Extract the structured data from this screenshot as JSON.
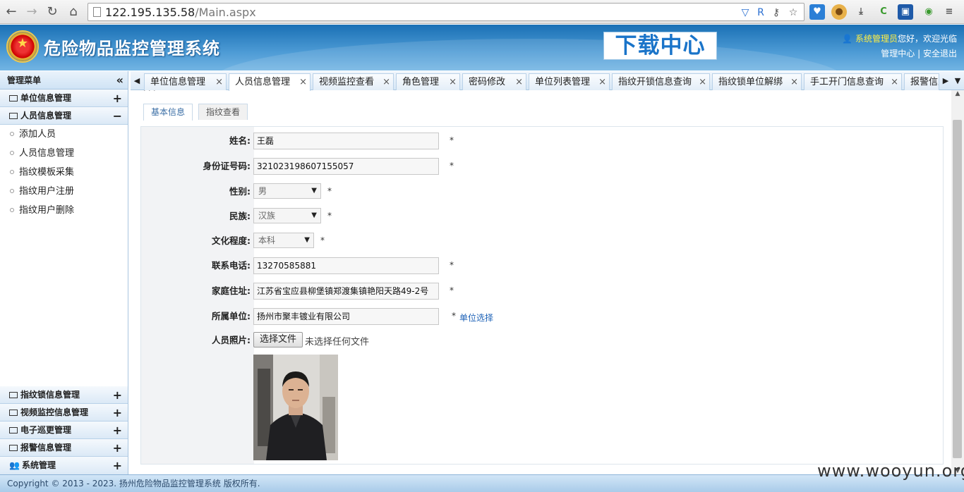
{
  "browser": {
    "url_host": "122.195.135.58",
    "url_path": "/Main.aspx"
  },
  "header": {
    "title": "危险物品监控管理系统",
    "download_label": "下载中心",
    "user_name": "系统管理员",
    "greeting": "您好，欢迎光临",
    "admin_center": "管理中心",
    "separator": "|",
    "logout": "安全退出"
  },
  "sidebar": {
    "title": "管理菜单",
    "top_sections": [
      {
        "label": "单位信息管理",
        "toggle": "+"
      },
      {
        "label": "人员信息管理",
        "toggle": "−"
      }
    ],
    "items": [
      "添加人员",
      "人员信息管理",
      "指纹模板采集",
      "指纹用户注册",
      "指纹用户删除"
    ],
    "bottom_sections": [
      {
        "label": "指纹锁信息管理",
        "toggle": "+"
      },
      {
        "label": "视频监控信息管理",
        "toggle": "+"
      },
      {
        "label": "电子巡更管理",
        "toggle": "+"
      },
      {
        "label": "报警信息管理",
        "toggle": "+"
      },
      {
        "label": "系统管理",
        "toggle": "+"
      }
    ]
  },
  "tabs": [
    {
      "label": "单位信息管理"
    },
    {
      "label": "人员信息管理"
    },
    {
      "label": "视频监控查看"
    },
    {
      "label": "角色管理"
    },
    {
      "label": "密码修改"
    },
    {
      "label": "单位列表管理"
    },
    {
      "label": "指纹开锁信息查询"
    },
    {
      "label": "指纹锁单位解绑"
    },
    {
      "label": "手工开门信息查询"
    },
    {
      "label": "报警信息"
    }
  ],
  "inner_tabs": [
    "基本信息",
    "指纹查看"
  ],
  "form": {
    "name_label": "姓名:",
    "name_value": "王磊",
    "id_label": "身份证号码:",
    "id_value": "321023198607155057",
    "gender_label": "性别:",
    "gender_value": "男",
    "ethnic_label": "民族:",
    "ethnic_value": "汉族",
    "edu_label": "文化程度:",
    "edu_value": "本科",
    "phone_label": "联系电话:",
    "phone_value": "13270585881",
    "address_label": "家庭住址:",
    "address_value": "江苏省宝应县柳堡镇郑渡集镇艳阳天路49-2号",
    "unit_label": "所属单位:",
    "unit_value": "扬州市聚丰镀业有限公司",
    "unit_select": "单位选择",
    "photo_label": "人员照片:",
    "file_button": "选择文件",
    "file_none": "未选择任何文件",
    "required": "*"
  },
  "footer": {
    "copyright": "Copyright © 2013 - 2023. 扬州危险物品监控管理系统 版权所有."
  },
  "watermark": "www.wooyun.org"
}
